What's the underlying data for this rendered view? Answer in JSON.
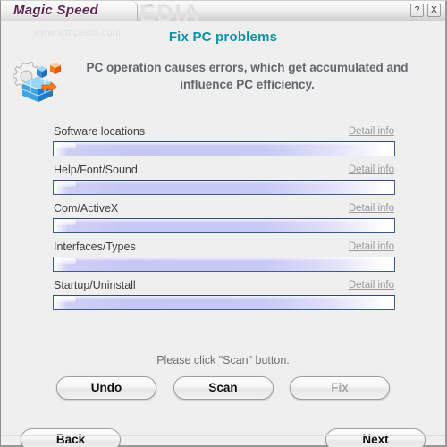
{
  "window": {
    "title": "Magic Speed",
    "trademark": "™",
    "watermark_large": "SOFTPEDIA",
    "watermark_small": "www.softpedia.com",
    "help_button": "?",
    "close_button": "X"
  },
  "header": {
    "page_title": "Fix PC problems",
    "title_color": "#0a93a8",
    "description": "PC operation causes errors, which get accumulated and influence PC efficiency.",
    "icon": "registry-gear-icon"
  },
  "scan_list": {
    "detail_link_label": "Detail info",
    "items": [
      {
        "label": "Software locations",
        "progress": 0
      },
      {
        "label": "Help/Font/Sound",
        "progress": 0
      },
      {
        "label": "Com/ActiveX",
        "progress": 0
      },
      {
        "label": "Interfaces/Types",
        "progress": 0
      },
      {
        "label": "Startup/Uninstall",
        "progress": 0
      }
    ]
  },
  "status": {
    "message": "Please click \"Scan\" button."
  },
  "actions": {
    "undo": "Undo",
    "scan": "Scan",
    "fix": "Fix",
    "fix_disabled": true
  },
  "navigation": {
    "back": "Back",
    "next": "Next"
  },
  "colors": {
    "accent": "#0a93a8",
    "title": "#5b2350",
    "progress_border": "#3f5d8c",
    "progress_fill": "#c7c7f4",
    "window_bg": "#efefef"
  }
}
